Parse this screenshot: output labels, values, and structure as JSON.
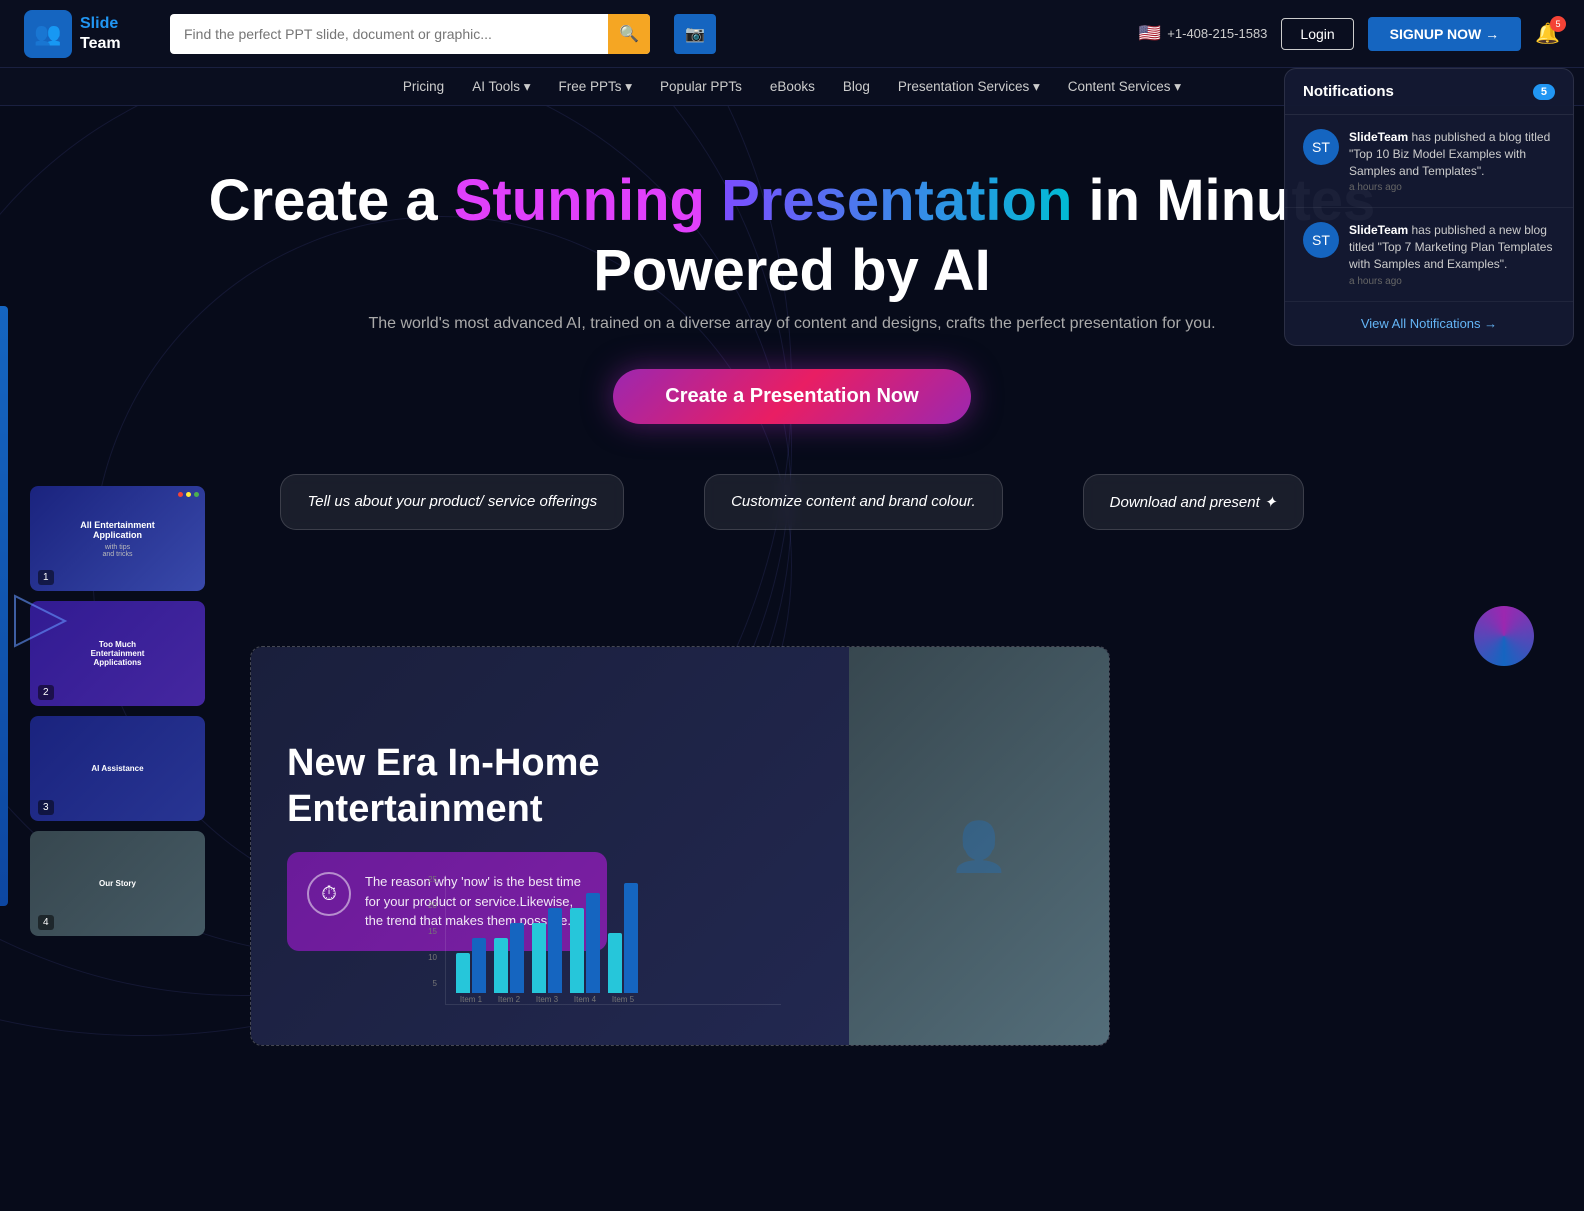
{
  "header": {
    "logo": {
      "icon": "👥",
      "line1": "Slide",
      "line2": "Team"
    },
    "search": {
      "placeholder": "Find the perfect PPT slide, document or graphic...",
      "search_btn": "🔍",
      "camera_btn": "📷"
    },
    "phone": "+1-408-215-1583",
    "login_label": "Login",
    "signup_label": "SIGNUP NOW →",
    "bell_count": "5"
  },
  "nav": {
    "items": [
      {
        "label": "Pricing"
      },
      {
        "label": "AI Tools ▾"
      },
      {
        "label": "Free PPTs ▾"
      },
      {
        "label": "Popular PPTs"
      },
      {
        "label": "eBooks"
      },
      {
        "label": "Blog"
      },
      {
        "label": "Presentation Services ▾"
      },
      {
        "label": "Content Services ▾"
      }
    ]
  },
  "hero": {
    "headline_before": "Create a",
    "headline_pink": "Stunning",
    "headline_gradient": "Presentation",
    "headline_after": "in Minutes",
    "headline_line2": "Powered by AI",
    "subtext": "The world's most advanced AI, trained on a diverse array of content and designs, crafts the perfect presentation for you.",
    "cta_label": "Create a Presentation Now"
  },
  "workflow": {
    "step1": "Tell us about your product/ service offerings",
    "step2": "Customize content and brand colour.",
    "step3": "Download and present ✦"
  },
  "slides": [
    {
      "num": "1",
      "title": "All Entertainment Application",
      "subtitle": "with tips and tricks"
    },
    {
      "num": "2",
      "title": "Too Much Entertainment Applications"
    },
    {
      "num": "3",
      "title": "AI Assistance"
    },
    {
      "num": "4",
      "title": "Our Story"
    }
  ],
  "preview": {
    "title": "New Era In-Home Entertainment",
    "card_text": "The reason why 'now' is the best time for your product or service.Likewise, the trend that makes them possible.",
    "chart": {
      "y_labels": [
        "25",
        "20",
        "15",
        "10",
        "5",
        ""
      ],
      "items": [
        {
          "label": "Item 1",
          "heights": [
            40,
            55
          ]
        },
        {
          "label": "Item 2",
          "heights": [
            55,
            70
          ]
        },
        {
          "label": "Item 3",
          "heights": [
            70,
            85
          ]
        },
        {
          "label": "Item 4",
          "heights": [
            85,
            100
          ]
        },
        {
          "label": "Item 5",
          "heights": [
            60,
            110
          ]
        }
      ]
    }
  },
  "notifications": {
    "title": "Notifications",
    "count": "5",
    "items": [
      {
        "text": "SlideTeam has published a blog titled \"Top 10 Biz Model Examples with Samples and Templates\".",
        "time": "a hours ago"
      },
      {
        "text": "SlideTeam has published a new blog titled \"Top 7 Marketing Plan Templates with Samples and Examples\".",
        "time": "a hours ago"
      }
    ],
    "view_all": "View All Notifications →"
  }
}
